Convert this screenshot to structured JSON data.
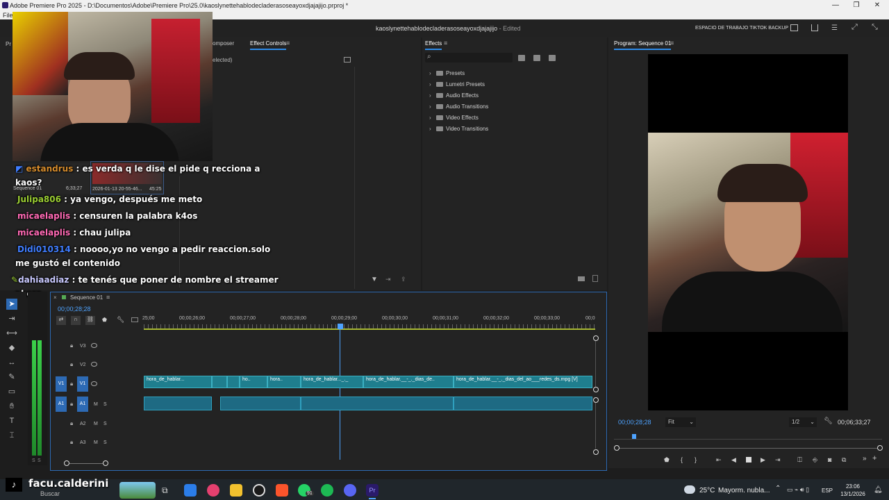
{
  "window": {
    "title": "Adobe Premiere Pro 2025 - D:\\Documentos\\Adobe\\Premiere Pro\\25.0\\kaoslynettehablodecladerasoseayoxdjajajijo.prproj *",
    "min": "—",
    "max": "❐",
    "close": "✕"
  },
  "menu": {
    "file": "File"
  },
  "header": {
    "project_title": "kaoslynettehablodecladerasoseayoxdjajajijo",
    "edited": "- Edited",
    "workspace": "ESPACIO DE TRABAJO TIKTOK BACKUP"
  },
  "source_panel": {
    "tab_composer": "omposer",
    "tab_effect_controls": "Effect Controls",
    "no_clip": "elected)",
    "pr_tab": "Pr"
  },
  "project_thumb": {
    "seq_name": "Sequence 01",
    "seq_duration": "6;33;27",
    "clip_name": "2026-01-13 20-55-46...",
    "clip_duration": "45:25"
  },
  "effects": {
    "tab": "Effects",
    "items": [
      "Presets",
      "Lumetri Presets",
      "Audio Effects",
      "Audio Transitions",
      "Video Effects",
      "Video Transitions"
    ]
  },
  "program": {
    "tab": "Program: Sequence 01",
    "timecode": "00;00;28;28",
    "fit": "Fit",
    "resolution": "1/2",
    "duration": "00;06;33;27"
  },
  "chat": [
    {
      "user": "estandrus",
      "user_color": "#d58b2b",
      "text": " : es verda q le dise  el pide q recciona a"
    },
    {
      "user": "",
      "user_color": "#ffffff",
      "text": "kaos?"
    },
    {
      "user": "Julipa806",
      "user_color": "#9acd32",
      "text": " : ya vengo, después me meto"
    },
    {
      "user": "micaelaplis",
      "user_color": "#ff69b4",
      "text": " : censuren la palabra k4os"
    },
    {
      "user": "micaelaplis",
      "user_color": "#ff69b4",
      "text": " : chau julipa"
    },
    {
      "user": "Didi010314",
      "user_color": "#3f7dff",
      "text": " : noooo,yo no vengo a pedir reaccion.solo"
    },
    {
      "user": "",
      "user_color": "#ffffff",
      "text": "me gustó el contenido"
    },
    {
      "user": "dahiaadiaz",
      "user_color": "#c9c9ff",
      "text": " : te tenés que poner de nombre el streamer"
    },
    {
      "user": "",
      "user_color": "#ffffff",
      "text": "ahora"
    }
  ],
  "timeline": {
    "tab": "Sequence 01",
    "timecode": "00;00;28;28",
    "ticks": [
      "25;00",
      "00;00;26;00",
      "00;00;27;00",
      "00;00;28;00",
      "00;00;29;00",
      "00;00;30;00",
      "00;00;31;00",
      "00;00;32;00",
      "00;00;33;00",
      "00;0"
    ],
    "video_tracks": [
      "V3",
      "V2",
      "V1"
    ],
    "audio_tracks": [
      "A1",
      "A2",
      "A3"
    ],
    "src_v1": "V1",
    "src_a1": "A1",
    "m": "M",
    "s": "S",
    "clips": [
      "hora_de_hablar...",
      "ho..",
      "hora..",
      "hora_de_hablar..._._",
      "hora_de_hablar.__-_._dias_de..",
      "hora_de_hablar.__-_._dias_del_ao___redes_ds.mpg [V]"
    ]
  },
  "meter": {
    "s1": "S",
    "s2": "S"
  },
  "overlay": {
    "tiktok_user": "facu.calderini"
  },
  "taskbar": {
    "search": "Buscar",
    "weather_temp": "25°C",
    "weather_desc": "Mayorm. nubla...",
    "lang": "ESP",
    "time": "23:06",
    "date": "13/1/2026",
    "whatsapp_badge": "91"
  },
  "colors": {
    "accent": "#2d8ceb",
    "clip_video": "#1f7e8e",
    "clip_audio": "#1e6a83"
  }
}
